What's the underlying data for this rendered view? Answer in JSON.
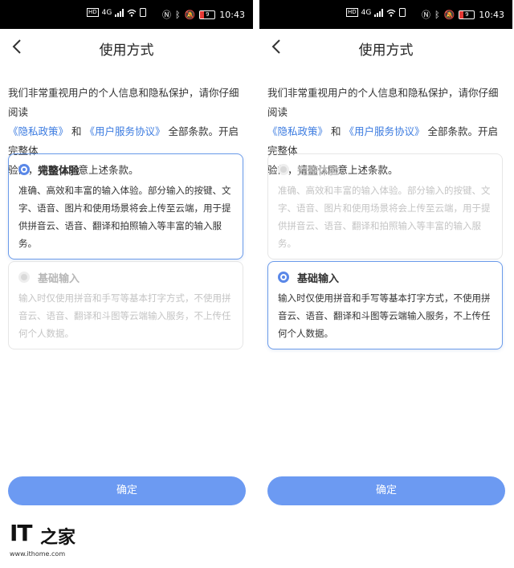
{
  "status_bar": {
    "network_badge": "HD",
    "signal": "4G",
    "battery": "9",
    "time": "10:43"
  },
  "header": {
    "title": "使用方式"
  },
  "intro": {
    "line1": "我们非常重视用户的个人信息和隐私保护，请你仔细阅读",
    "privacy_link": "《隐私政策》",
    "and": "和",
    "service_link": "《用户服务协议》",
    "after_links": "全部条款。开启完整体",
    "line3": "验前，请确认同意上述条款。"
  },
  "options": {
    "full": {
      "title": "完整体验",
      "description": "准确、高效和丰富的输入体验。部分输入的按键、文字、语音、图片和使用场景将会上传至云端，用于提供拼音云、语音、翻译和拍照输入等丰富的输入服务。"
    },
    "basic": {
      "title": "基础输入",
      "description": "输入时仅使用拼音和手写等基本打字方式，不使用拼音云、语音、翻译和斗图等云端输入服务，不上传任何个人数据。"
    }
  },
  "left_panel": {
    "selected": "full"
  },
  "right_panel": {
    "selected": "basic"
  },
  "confirm_button": {
    "label": "确定"
  },
  "watermark": {
    "logo_text": "IT",
    "logo_glyph": "之家",
    "url": "www.ithome.com"
  },
  "colors": {
    "accent": "#6c9af2",
    "link": "#3b7be0",
    "card_border_selected": "#6b9bea"
  },
  "icons": {
    "back": "chevron-left-icon",
    "radio_selected": "radio-selected-icon",
    "radio_unselected": "radio-unselected-icon"
  }
}
